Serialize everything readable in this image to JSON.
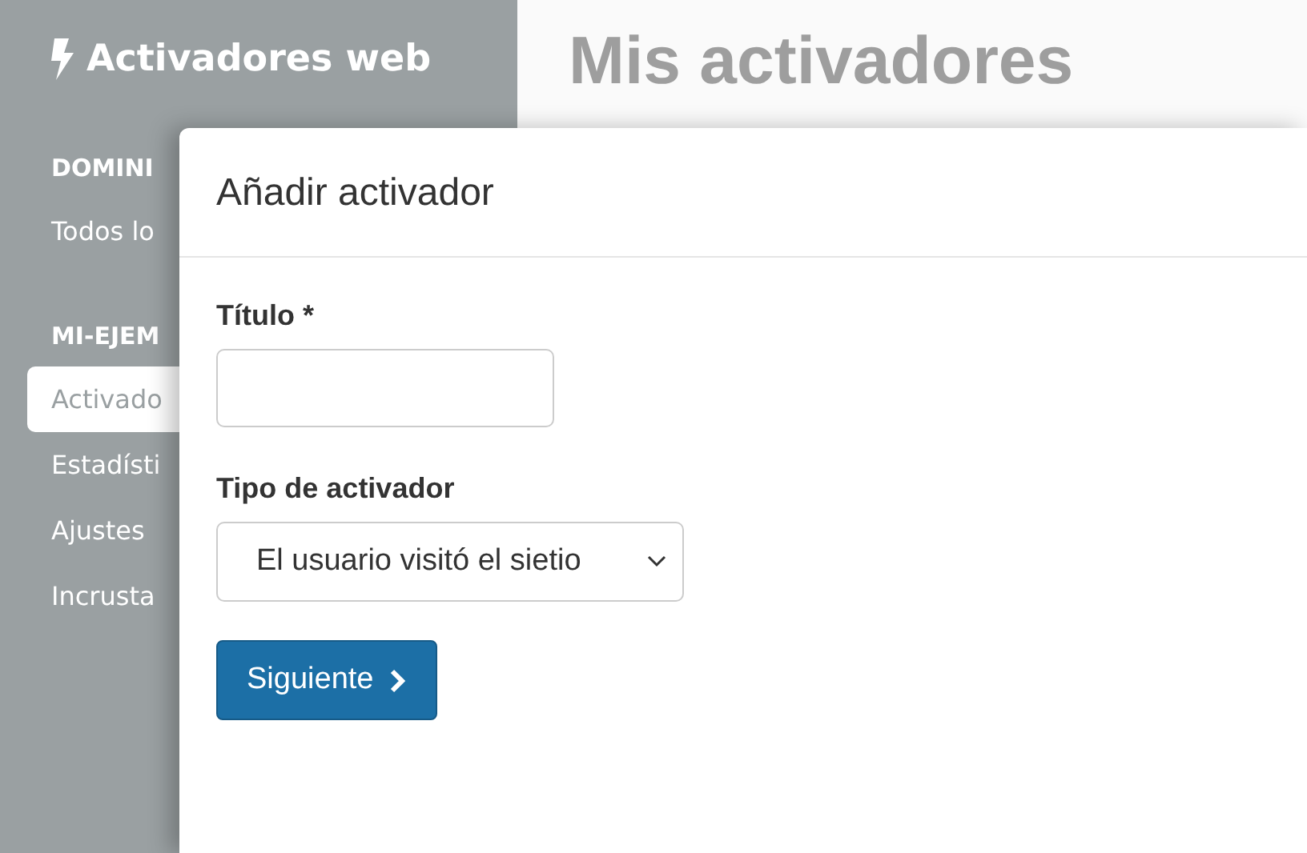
{
  "sidebar": {
    "brand": "Activadores web",
    "sections": [
      {
        "heading": "DOMINI",
        "items": [
          {
            "label": "Todos lo",
            "selected": false
          }
        ]
      },
      {
        "heading": "MI-EJEM",
        "items": [
          {
            "label": "Activado",
            "selected": true
          },
          {
            "label": "Estadísti",
            "selected": false
          },
          {
            "label": "Ajustes",
            "selected": false
          },
          {
            "label": "Incrusta",
            "selected": false
          }
        ]
      }
    ]
  },
  "page": {
    "title": "Mis activadores"
  },
  "modal": {
    "title": "Añadir activador",
    "fields": [
      {
        "kind": "text",
        "label": "Título *"
      },
      {
        "kind": "select",
        "label": "Tipo de activador",
        "value": "El usuario visitó el sietio"
      }
    ],
    "button": "Siguiente"
  }
}
